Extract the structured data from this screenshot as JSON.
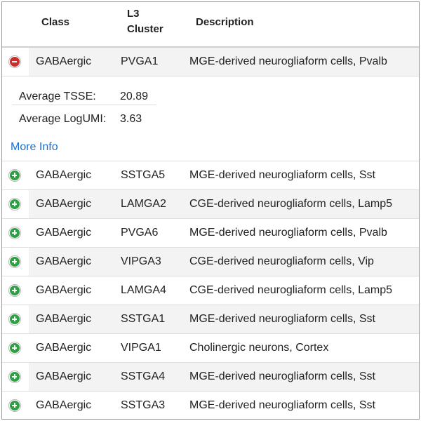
{
  "header": {
    "class": "Class",
    "cluster_line1": "L3",
    "cluster_line2": "Cluster",
    "description": "Description"
  },
  "expanded_row": {
    "class": "GABAergic",
    "cluster": "PVGA1",
    "description": "MGE-derived neurogliaform cells, Pvalb",
    "toggle": "minus-icon"
  },
  "details": {
    "tsse_label": "Average TSSE:",
    "tsse_value": "20.89",
    "logumi_label": "Average LogUMI:",
    "logumi_value": "3.63",
    "more_info": "More Info"
  },
  "rows": [
    {
      "class": "GABAergic",
      "cluster": "SSTGA5",
      "description": "MGE-derived neurogliaform cells, Sst"
    },
    {
      "class": "GABAergic",
      "cluster": "LAMGA2",
      "description": "CGE-derived neurogliaform cells, Lamp5"
    },
    {
      "class": "GABAergic",
      "cluster": "PVGA6",
      "description": "MGE-derived neurogliaform cells, Pvalb"
    },
    {
      "class": "GABAergic",
      "cluster": "VIPGA3",
      "description": "CGE-derived neurogliaform cells, Vip"
    },
    {
      "class": "GABAergic",
      "cluster": "LAMGA4",
      "description": "CGE-derived neurogliaform cells, Lamp5"
    },
    {
      "class": "GABAergic",
      "cluster": "SSTGA1",
      "description": "MGE-derived neurogliaform cells, Sst"
    },
    {
      "class": "GABAergic",
      "cluster": "VIPGA1",
      "description": "Cholinergic neurons, Cortex"
    },
    {
      "class": "GABAergic",
      "cluster": "SSTGA4",
      "description": "MGE-derived neurogliaform cells, Sst"
    },
    {
      "class": "GABAergic",
      "cluster": "SSTGA3",
      "description": "MGE-derived neurogliaform cells, Sst"
    }
  ],
  "colors": {
    "expand_icon": "#2ea043",
    "collapse_icon": "#c9302c",
    "link": "#1a6fd8",
    "stripe": "#f3f3f3"
  }
}
